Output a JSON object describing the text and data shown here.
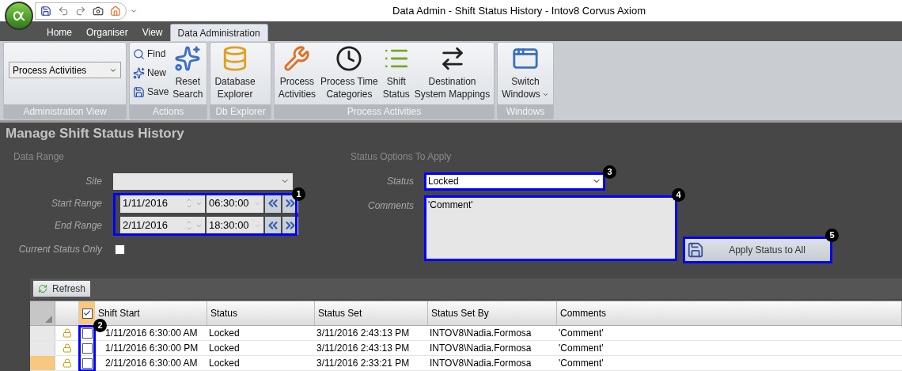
{
  "window": {
    "title": "Data Admin - Shift Status History - Intov8 Corvus Axiom"
  },
  "ribbon_tabs": [
    {
      "label": "Home",
      "selected": false
    },
    {
      "label": "Organiser",
      "selected": false
    },
    {
      "label": "View",
      "selected": false
    },
    {
      "label": "Data Administration",
      "selected": true
    }
  ],
  "ribbon_groups": [
    {
      "label": "Administration View",
      "items": [
        {
          "kind": "dropdown",
          "value": "Process Activities"
        }
      ]
    },
    {
      "label": "Actions",
      "items": [
        {
          "kind": "small",
          "lines": [
            "Find"
          ]
        },
        {
          "kind": "small",
          "lines": [
            "New"
          ]
        },
        {
          "kind": "small",
          "lines": [
            "Save"
          ]
        },
        {
          "kind": "large",
          "lines": [
            "Reset",
            "Search"
          ]
        }
      ]
    },
    {
      "label": "Db Explorer",
      "items": [
        {
          "kind": "large",
          "lines": [
            "Database",
            "Explorer"
          ]
        }
      ]
    },
    {
      "label": "Process Activities",
      "items": [
        {
          "kind": "large",
          "lines": [
            "Process",
            "Activities"
          ]
        },
        {
          "kind": "large",
          "lines": [
            "Process Time",
            "Categories"
          ]
        },
        {
          "kind": "large",
          "lines": [
            "Shift",
            "Status"
          ]
        },
        {
          "kind": "large",
          "lines": [
            "Destination",
            "System Mappings"
          ]
        }
      ]
    },
    {
      "label": "Windows",
      "items": [
        {
          "kind": "menu",
          "lines": [
            "Switch",
            "Windows"
          ]
        }
      ]
    }
  ],
  "page_title": "Manage Shift Status History",
  "data_range": {
    "heading": "Data Range",
    "site": {
      "label": "Site"
    },
    "start_range": {
      "label": "Start Range",
      "date": "1/11/2016",
      "time": "06:30:00"
    },
    "end_range": {
      "label": "End Range",
      "date": "2/11/2016",
      "time": "18:30:00"
    },
    "current_status_only": {
      "label": "Current Status Only",
      "checked": false
    }
  },
  "status_options": {
    "heading": "Status Options To Apply",
    "status": {
      "label": "Status",
      "value": "Locked"
    },
    "comments": {
      "label": "Comments",
      "value": "'Comment'"
    },
    "apply_button": "Apply Status to All"
  },
  "grid": {
    "refresh_button": "Refresh",
    "select_all_checked": true,
    "columns": [
      "Shift Start",
      "Status",
      "Status Set",
      "Status Set By",
      "Comments"
    ],
    "rows": [
      {
        "selected": false,
        "checked": false,
        "cells": [
          "1/11/2016 6:30:00 AM",
          "Locked",
          "3/11/2016 2:43:13 PM",
          "INTOV8\\Nadia.Formosa",
          "'Comment'"
        ]
      },
      {
        "selected": false,
        "checked": false,
        "cells": [
          "1/11/2016 6:30:00 PM",
          "Locked",
          "3/11/2016 2:43:13 PM",
          "INTOV8\\Nadia.Formosa",
          "'Comment'"
        ]
      },
      {
        "selected": true,
        "checked": false,
        "cells": [
          "2/11/2016 6:30:00 AM",
          "Locked",
          "3/11/2016 2:33:21 PM",
          "INTOV8\\Nadia.Formosa",
          "'Comment'"
        ]
      }
    ]
  },
  "callouts": [
    "1",
    "2",
    "3",
    "4",
    "5"
  ]
}
